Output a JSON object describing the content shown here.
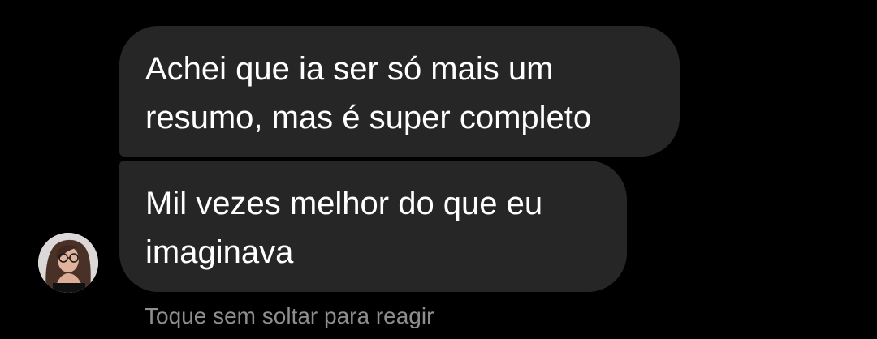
{
  "messages": [
    {
      "text": "Achei que ia ser só mais um\nresumo, mas é super completo"
    },
    {
      "text": "Mil vezes melhor do que eu\nimaginava"
    }
  ],
  "hint_text": "Toque sem soltar para reagir",
  "sender": {
    "avatar_icon": "profile-photo"
  },
  "colors": {
    "background": "#000000",
    "bubble": "#262626",
    "message_text": "#ffffff",
    "hint_text": "#8e8e8e"
  }
}
